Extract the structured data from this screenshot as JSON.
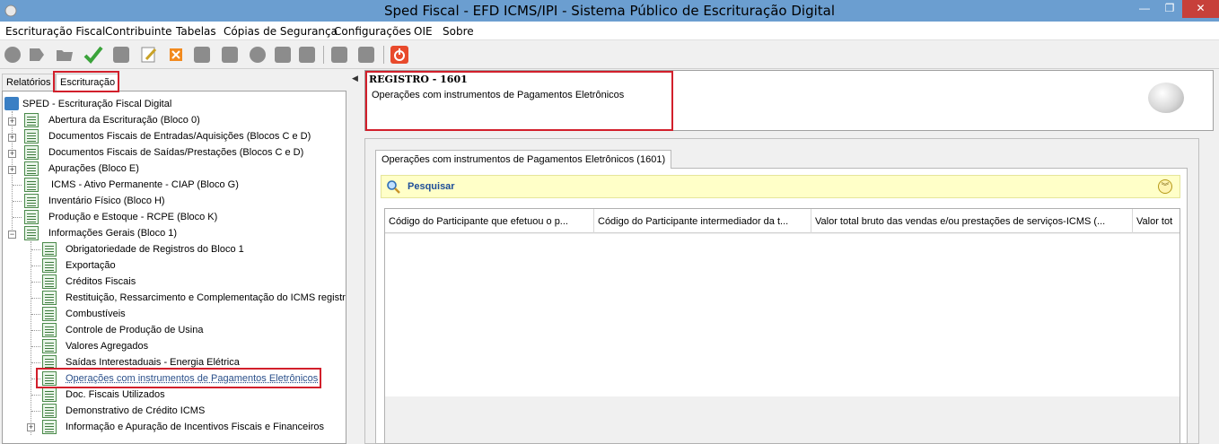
{
  "window": {
    "title": "Sped Fiscal - EFD ICMS/IPI - Sistema Público de Escrituração Digital",
    "minimize_glyph": "—",
    "maximize_glyph": "❐",
    "close_glyph": "✕"
  },
  "menu": [
    "Escrituração Fiscal",
    "Contribuinte",
    "Tabelas",
    "Cópias de Segurança",
    "Configurações",
    "OIE",
    "Sobre"
  ],
  "toolbar": {
    "icons": [
      "new-file-icon",
      "open-arrow-icon",
      "open-folder-icon",
      "validate-check-icon",
      "copy-icon",
      "edit-icon",
      "delete-icon",
      "sign-icon",
      "print-icon",
      "transmit-icon",
      "mail-icon",
      "restore-icon",
      "save-icon",
      "save-all-icon",
      "exit-icon"
    ],
    "accent_exit": "#e84a2c",
    "accent_check": "#3aa33a"
  },
  "left_tabs": [
    "Relatórios",
    "Escrituração"
  ],
  "tree": {
    "root": "SPED - Escrituração Fiscal Digital",
    "level1": [
      "Abertura da Escrituração (Bloco 0)",
      "Documentos Fiscais de Entradas/Aquisições (Blocos C e D)",
      "Documentos Fiscais de Saídas/Prestações (Blocos C e D)",
      "Apurações (Bloco E)",
      "ICMS - Ativo Permanente - CIAP (Bloco G)",
      "Inventário Físico (Bloco H)",
      "Produção e Estoque - RCPE (Bloco K)",
      "Informações Gerais (Bloco 1)"
    ],
    "bloco1_children": [
      "Obrigatoriedade de Registros do Bloco 1",
      "Exportação",
      "Créditos Fiscais",
      "Restituição, Ressarcimento e Complementação do ICMS registro",
      "Combustíveis",
      "Controle de Produção de Usina",
      "Valores Agregados",
      "Saídas Interestaduais - Energia Elétrica",
      "Operações com instrumentos de Pagamentos Eletrônicos",
      "Doc. Fiscais Utilizados",
      "Demonstrativo de Crédito ICMS",
      "Informação e Apuração de Incentivos Fiscais e Financeiros"
    ]
  },
  "register": {
    "title": "REGISTRO - 1601",
    "description": "Operações com instrumentos de Pagamentos Eletrônicos"
  },
  "content_tab": "Operações com instrumentos de Pagamentos Eletrônicos (1601)",
  "search": {
    "label": "Pesquisar",
    "collapse_glyph": "︾"
  },
  "grid": {
    "columns": [
      "Código do Participante que efetuou o p...",
      "Código do Participante intermediador da t...",
      "Valor total bruto das vendas e/ou prestações de serviços-ICMS (...",
      "Valor tot"
    ]
  },
  "colors": {
    "titlebar": "#6b9ed0",
    "highlight_box": "#d21f2b",
    "search_bg": "#ffffc8",
    "search_text": "#1e4e99"
  }
}
